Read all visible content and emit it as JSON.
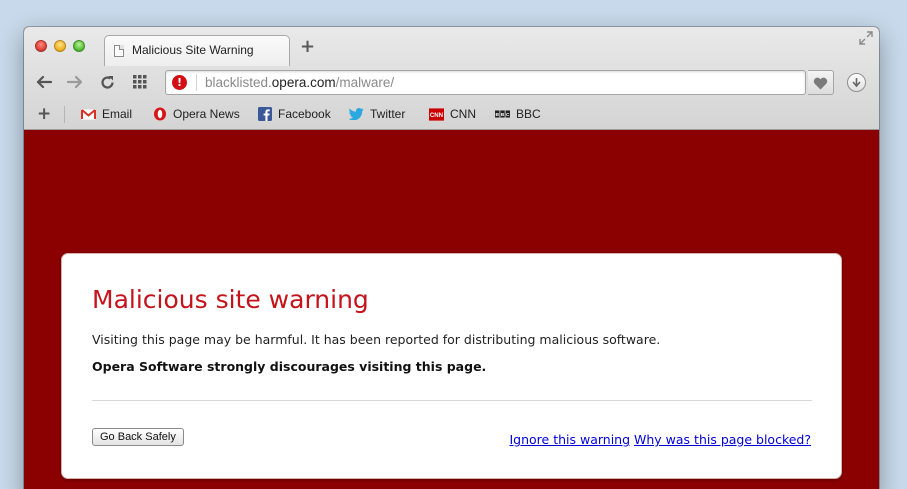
{
  "tab": {
    "title": "Malicious Site Warning",
    "new_tab_symbol": "+"
  },
  "address_bar": {
    "prefix": "blacklisted.",
    "host": "opera.com",
    "path": "/malware/",
    "warning_symbol": "!"
  },
  "bookmarks": [
    {
      "label": "Email",
      "icon": "gmail-icon"
    },
    {
      "label": "Opera News",
      "icon": "opera-icon"
    },
    {
      "label": "Facebook",
      "icon": "facebook-icon"
    },
    {
      "label": "Twitter",
      "icon": "twitter-icon"
    },
    {
      "label": "CNN",
      "icon": "cnn-icon"
    },
    {
      "label": "BBC",
      "icon": "bbc-icon"
    }
  ],
  "warning": {
    "title": "Malicious site warning",
    "message": "Visiting this page may be harmful. It has been reported for distributing malicious software.",
    "emphasis": "Opera Software strongly discourages visiting this page.",
    "back_button": "Go Back Safely",
    "ignore_link": "Ignore this warning",
    "why_link": "Why was this page blocked?"
  },
  "colors": {
    "page_background": "#8b0000",
    "title_red": "#c4131b",
    "link_blue": "#0000d9"
  }
}
